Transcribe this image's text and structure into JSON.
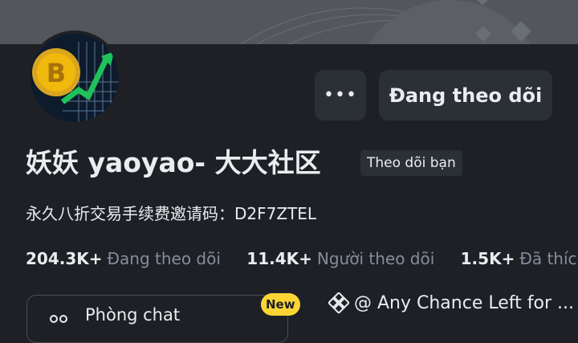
{
  "header": {
    "more_label": "•••",
    "follow_label": "Đang theo dõi"
  },
  "profile": {
    "name": "妖妖 yaoyao- 大大社区",
    "follows_you": "Theo dõi bạn",
    "bio": "永久八折交易手续费邀请码：D2F7ZTEL"
  },
  "stats": [
    {
      "value": "204.3K+",
      "label": "Đang theo dõi"
    },
    {
      "value": "11.4K+",
      "label": "Người theo dõi"
    },
    {
      "value": "1.5K+",
      "label": "Đã thích"
    }
  ],
  "chat": {
    "label": "Phòng chat",
    "badge": "New"
  },
  "tag": {
    "text": "@ Any Chance Left for ..."
  },
  "colors": {
    "background": "#1e2026",
    "button": "#2b2f36",
    "muted_text": "#848e9c",
    "badge": "#fcd535",
    "bitcoin": "#f0b90b",
    "trend": "#1fc25a"
  },
  "icons": {
    "more": "more-dots-icon",
    "chat": "chat-people-icon",
    "tag": "binance-diamond-icon"
  }
}
